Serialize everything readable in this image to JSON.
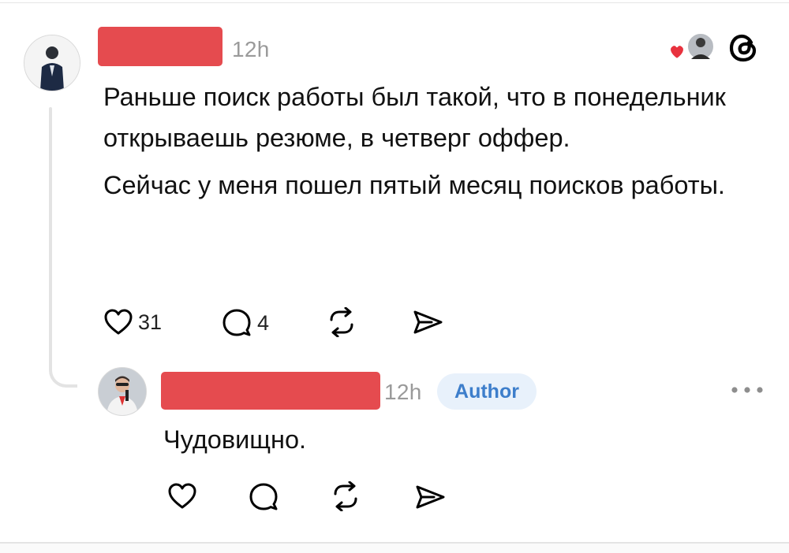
{
  "post": {
    "timestamp": "12h",
    "paragraphs": [
      "Раньше поиск работы был такой, что в понедельник открываешь резюме, в четверг оффер.",
      "Сейчас у меня пошел пятый месяц поисков работы."
    ],
    "actions": {
      "like_count": "31",
      "comment_count": "4"
    }
  },
  "reply": {
    "timestamp": "12h",
    "badge": "Author",
    "text": "Чудовищно."
  },
  "colors": {
    "redaction": "#e54b4f",
    "badge_bg": "#e8f1fb",
    "badge_text": "#3d7ecb",
    "like_heart": "#e8323e",
    "muted": "#9a9a9a"
  },
  "icons": {
    "like": "heart-outline-icon",
    "comment": "speech-bubble-icon",
    "repost": "repost-arrows-icon",
    "share": "paper-plane-icon",
    "brand": "threads-logo-icon",
    "more": "ellipsis-icon"
  }
}
